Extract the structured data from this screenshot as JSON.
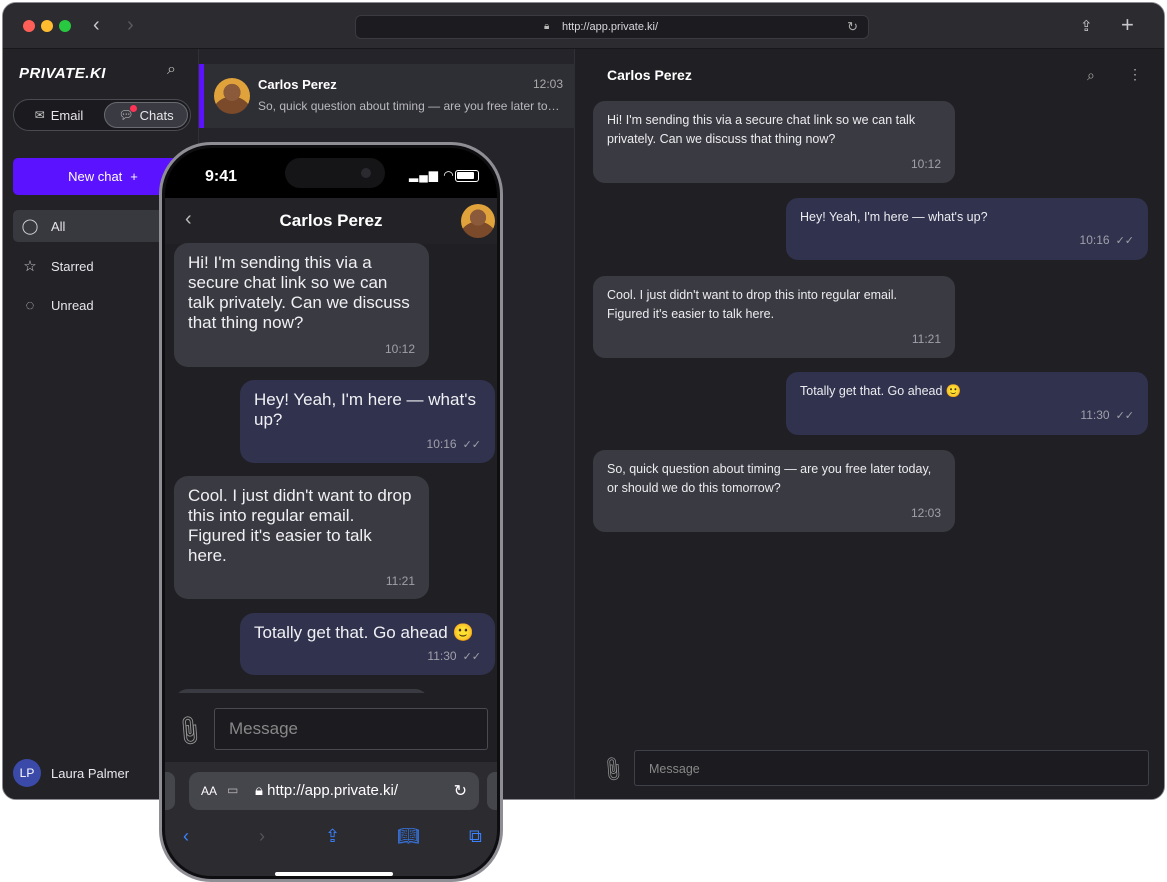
{
  "browser": {
    "url": "http://app.private.ki/"
  },
  "sidebar": {
    "logo": "PRIVATE.KI",
    "segments": {
      "email": "Email",
      "chats": "Chats"
    },
    "new_chat": "New chat",
    "items": [
      {
        "label": "All",
        "icon": "chat-bubble-icon"
      },
      {
        "label": "Starred",
        "icon": "star-icon"
      },
      {
        "label": "Unread",
        "icon": "unread-bubble-icon"
      }
    ],
    "user": {
      "initials": "LP",
      "name": "Laura Palmer"
    }
  },
  "chat_list": [
    {
      "name": "Carlos Perez",
      "time": "12:03",
      "preview": "So, quick question about timing — are you free later today, or should we do this tomorrow?"
    }
  ],
  "conversation": {
    "title": "Carlos Perez",
    "messages": [
      {
        "dir": "in",
        "text": "Hi! I'm sending this via a secure chat link so we can talk privately. Can we discuss that thing now?",
        "time": "10:12"
      },
      {
        "dir": "out",
        "text": "Hey! Yeah, I'm here — what's up?",
        "time": "10:16"
      },
      {
        "dir": "in",
        "text": "Cool. I just didn't want to drop this into regular email. Figured it's easier to talk here.",
        "time": "11:21"
      },
      {
        "dir": "out",
        "text": "Totally get that. Go ahead 🙂",
        "time": "11:30"
      },
      {
        "dir": "in",
        "text": "So, quick question about timing — are you free later today, or should we do this tomorrow?",
        "time": "12:03"
      }
    ],
    "composer_placeholder": "Message"
  },
  "phone": {
    "clock": "9:41",
    "title": "Carlos Perez",
    "composer_placeholder": "Message",
    "url": "http://app.private.ki/",
    "aa": "AA"
  },
  "colors": {
    "accent": "#5a12ff",
    "outgoing_bubble": "#30324e",
    "incoming_bubble": "#3a3a42"
  }
}
